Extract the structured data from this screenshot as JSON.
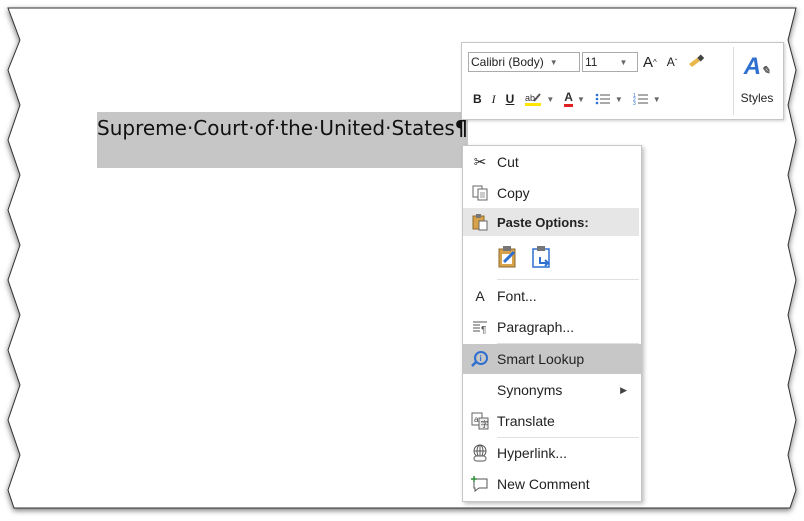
{
  "document": {
    "selected_text": "Supreme·Court·of·the·United·States",
    "pilcrow": "¶"
  },
  "mini_toolbar": {
    "font_name": "Calibri (Body)",
    "font_size": "11",
    "grow_font": "A",
    "shrink_font": "A",
    "bold": "B",
    "italic": "I",
    "underline": "U",
    "font_color": "A",
    "styles_label": "Styles"
  },
  "context_menu": {
    "cut": "Cut",
    "copy": "Copy",
    "paste_options": "Paste Options:",
    "font": "Font...",
    "paragraph": "Paragraph...",
    "smart_lookup": "Smart Lookup",
    "synonyms": "Synonyms",
    "translate": "Translate",
    "hyperlink": "Hyperlink...",
    "new_comment": "New Comment"
  },
  "colors": {
    "selection": "#c6c6c6",
    "highlight": "#c7c7c7",
    "accent_blue": "#2e6fd0",
    "font_color_red": "#e02020"
  }
}
